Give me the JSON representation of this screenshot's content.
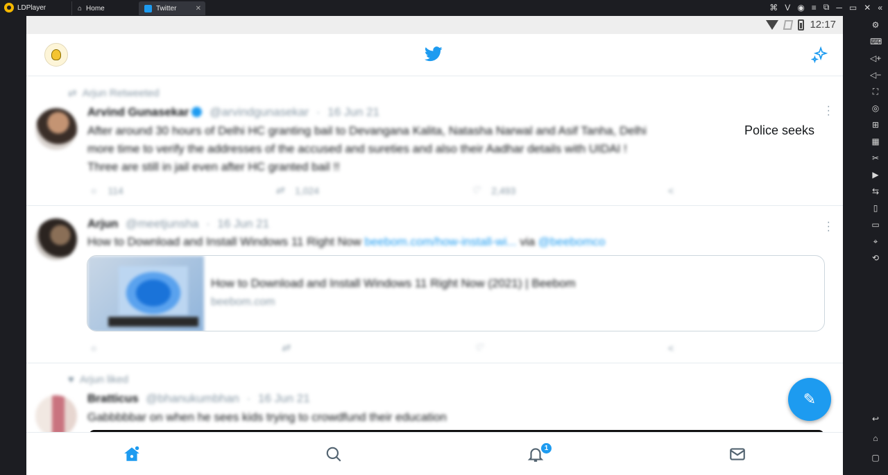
{
  "window": {
    "app_name": "LDPlayer",
    "tabs": [
      {
        "label": "Home"
      },
      {
        "label": "Twitter"
      }
    ]
  },
  "status": {
    "time": "12:17"
  },
  "feed": [
    {
      "context": "Arjun Retweeted",
      "name": "Arvind Gunasekar",
      "handle": "@arvindgunasekar",
      "date": "16 Jun 21",
      "text": "After around 30 hours of Delhi HC granting bail to Devangana Kalita, Natasha Narwal and Asif Tanha, Delhi",
      "text_visible_end": "Police seeks",
      "text2": "more time to verify the addresses of the accused and sureties and also their Aadhar details with UIDAI !",
      "text3": "Three are still in jail even after HC granted bail !!",
      "replies": "114",
      "retweets": "1,024",
      "likes": "2,493"
    },
    {
      "name": "Arjun",
      "handle": "@meetjunsha",
      "date": "16 Jun 21",
      "text": "How to Download and Install Windows 11 Right Now",
      "link": "beebom.com/how-install-wi...",
      "via": "via",
      "mention": "@beebomco",
      "card_title": "How to Download and Install Windows 11 Right Now (2021) | Beebom",
      "card_host": "beebom.com"
    },
    {
      "context": "Arjun liked",
      "name": "Bratticus",
      "handle": "@bhanukumbhan",
      "date": "16 Jun 21",
      "text": "Gabbbbbar on when he sees kids trying to crowdfund their education"
    }
  ],
  "nav": {
    "notifications_badge": "1"
  },
  "colors": {
    "accent": "#1d9bf0",
    "emulator_bg": "#1c1d22"
  }
}
